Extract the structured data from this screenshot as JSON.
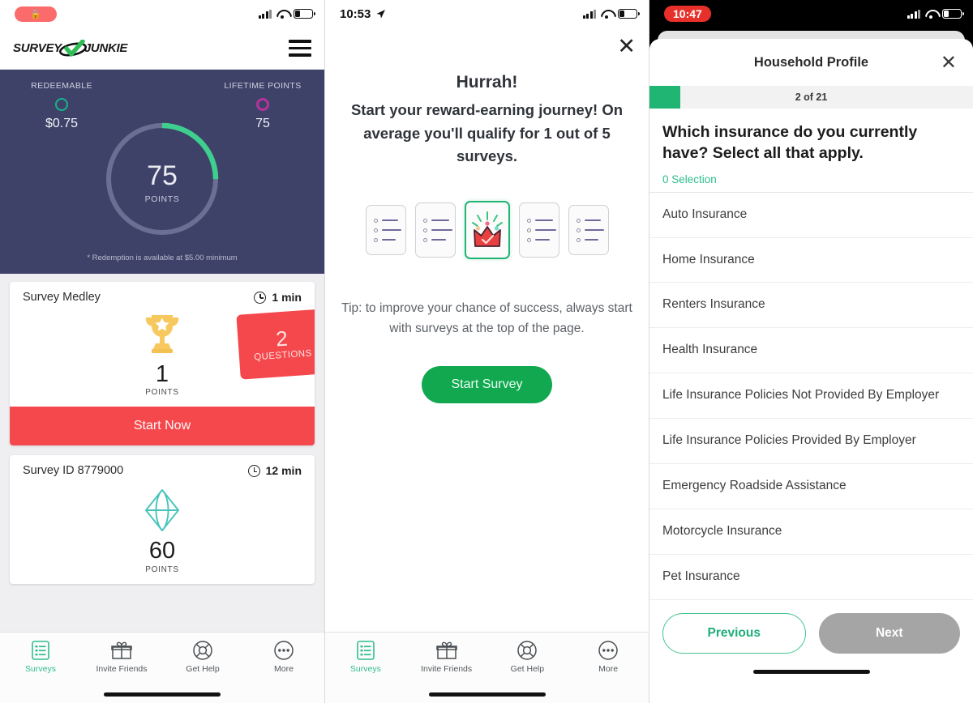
{
  "panel1": {
    "statusbar": {
      "rec_label": "",
      "rec_icon": "record-pill",
      "signal_icon": "cellular-icon",
      "wifi_icon": "wifi-icon",
      "battery_icon": "battery-icon"
    },
    "header": {
      "logo_left": "SURVEY",
      "logo_right": "JUNKIE",
      "menu_icon": "hamburger-icon"
    },
    "hero": {
      "redeemable_label": "REDEEMABLE",
      "redeemable_value": "$0.75",
      "lifetime_label": "LIFETIME POINTS",
      "lifetime_value": "75",
      "points_value": "75",
      "points_caption": "POINTS",
      "note": "* Redemption is available at $5.00 minimum",
      "ring_progress_percent": 25,
      "accent_green": "#3ecf8e",
      "track_color": "#6b6f93",
      "bg_color": "#3e4268",
      "redeemable_dot_color": "#18b38a",
      "lifetime_dot_color": "#b4339c"
    },
    "cards": [
      {
        "title": "Survey Medley",
        "time": "1 min",
        "points": "1",
        "points_caption": "POINTS",
        "icon": "trophy-icon",
        "tag_number": "2",
        "tag_label": "QUESTIONS",
        "cta": "Start Now",
        "cta_color": "#f4484c"
      },
      {
        "title": "Survey ID 8779000",
        "time": "12 min",
        "points": "60",
        "points_caption": "POINTS",
        "icon": "diamond-icon"
      }
    ],
    "tabs": [
      {
        "label": "Surveys",
        "icon": "surveys-list-icon",
        "active": true
      },
      {
        "label": "Invite Friends",
        "icon": "gift-icon",
        "active": false
      },
      {
        "label": "Get Help",
        "icon": "lifebuoy-icon",
        "active": false
      },
      {
        "label": "More",
        "icon": "ellipsis-icon",
        "active": false
      }
    ]
  },
  "panel2": {
    "statusbar": {
      "time": "10:53",
      "location_icon": "location-arrow-icon",
      "signal_icon": "cellular-icon",
      "wifi_icon": "wifi-icon",
      "battery_icon": "battery-icon"
    },
    "close_icon": "close-icon",
    "heading": "Hurrah!",
    "subheading": "Start your reward-earning journey!\nOn average you'll qualify for 1 out of 5 surveys.",
    "cards_illustration": {
      "count": 5,
      "highlighted_index": 2,
      "highlight_color": "#21b573",
      "crown_icon": "crown-icon"
    },
    "tip": "Tip: to improve your chance of success, always start with surveys at the top of the page.",
    "cta": "Start Survey",
    "cta_color": "#12a84f",
    "tabs": [
      {
        "label": "Surveys",
        "icon": "surveys-list-icon",
        "active": true
      },
      {
        "label": "Invite Friends",
        "icon": "gift-icon",
        "active": false
      },
      {
        "label": "Get Help",
        "icon": "lifebuoy-icon",
        "active": false
      },
      {
        "label": "More",
        "icon": "ellipsis-icon",
        "active": false
      }
    ]
  },
  "panel3": {
    "statusbar": {
      "time": "10:47",
      "time_pill_color": "#e8302a",
      "signal_icon": "cellular-icon",
      "wifi_icon": "wifi-icon",
      "battery_icon": "battery-icon"
    },
    "sheet_title": "Household Profile",
    "close_icon": "close-icon",
    "progress_label": "2 of 21",
    "progress_current": 2,
    "progress_total": 21,
    "progress_color": "#21b573",
    "question": "Which insurance do you currently have? Select all that apply.",
    "selection_label": "0 Selection",
    "selection_color": "#2fbd8f",
    "options": [
      "Auto Insurance",
      "Home Insurance",
      "Renters Insurance",
      "Health Insurance",
      "Life Insurance Policies Not Provided By Employer",
      "Life Insurance Policies Provided By Employer",
      "Emergency Roadside Assistance",
      "Motorcycle Insurance",
      "Pet Insurance"
    ],
    "previous_label": "Previous",
    "next_label": "Next",
    "next_disabled": true
  }
}
